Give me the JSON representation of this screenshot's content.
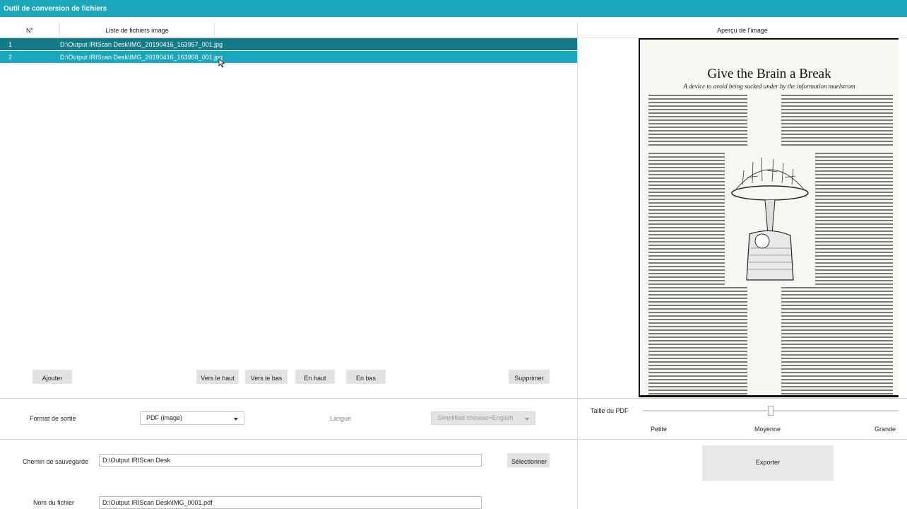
{
  "window": {
    "title": "Outil de conversion de fichiers"
  },
  "file_list": {
    "col_number": "N°",
    "col_files": "Liste de fichiers image",
    "rows": [
      {
        "num": "1",
        "path": "D:\\Output IRIScan Desk\\IMG_20190416_163957_001.jpg",
        "selected": true
      },
      {
        "num": "2",
        "path": "D:\\Output IRIScan Desk\\IMG_20190416_163958_001.jpg",
        "selected": false
      }
    ]
  },
  "toolbar": {
    "add": "Ajouter",
    "move_up": "Vers le haut",
    "move_down": "Vers le bas",
    "to_top": "En haut",
    "to_bottom": "En bas",
    "delete": "Supprimer"
  },
  "preview": {
    "header": "Aperçu de l'image",
    "doc_title": "Give the Brain a Break",
    "doc_subtitle": "A device to avoid being sucked under by the information maelstrom"
  },
  "output": {
    "format_label": "Format de sortie",
    "format_value": "PDF (image)",
    "language_label": "Langue",
    "language_value": "Simplified chinese+English"
  },
  "pdf_size": {
    "label": "Taille du PDF",
    "small": "Petite",
    "medium": "Moyenne",
    "large": "Grande",
    "level_fraction": 0.5
  },
  "save": {
    "path_label": "Chemin de sauvegarde",
    "path_value": "D:\\Output IRIScan Desk",
    "select_button": "Sélectionner",
    "filename_label": "Nom du fichier",
    "filename_value": "D:\\Output IRIScan Desk\\IMG_0001.pdf"
  },
  "export_button": "Exporter",
  "colors": {
    "accent": "#1aa7bb",
    "accent_selected": "#137a8a"
  }
}
